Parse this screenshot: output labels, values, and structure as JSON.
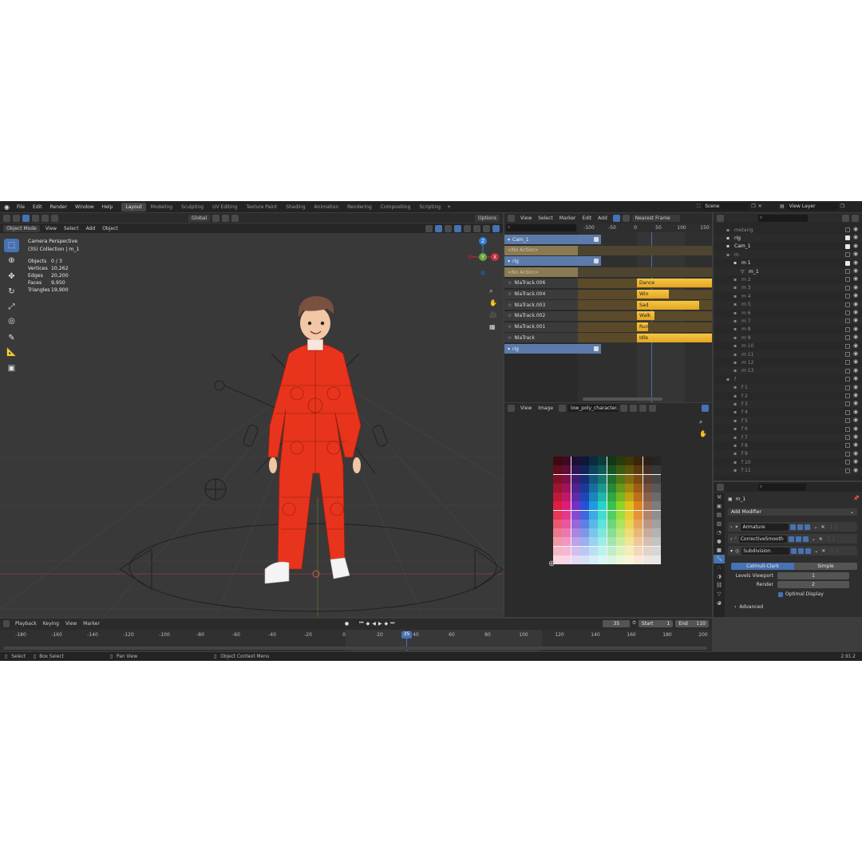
{
  "topbar": {
    "menus": [
      "File",
      "Edit",
      "Render",
      "Window",
      "Help"
    ],
    "workspaces": [
      "Layout",
      "Modeling",
      "Sculpting",
      "UV Editing",
      "Texture Paint",
      "Shading",
      "Animation",
      "Rendering",
      "Compositing",
      "Scripting"
    ],
    "active_workspace": "Layout",
    "add_tab": "+",
    "scene": "Scene",
    "view_layer": "View Layer"
  },
  "viewport": {
    "mode": "Object Mode",
    "menus": [
      "View",
      "Select",
      "Add",
      "Object"
    ],
    "orientation": "Global",
    "options": "Options",
    "camera_label": "Camera Perspective",
    "collection_label": "(35) Collection | m_1",
    "stats": [
      {
        "label": "Objects",
        "value": "0 / 3"
      },
      {
        "label": "Vertices",
        "value": "10,262"
      },
      {
        "label": "Edges",
        "value": "20,200"
      },
      {
        "label": "Faces",
        "value": "9,950"
      },
      {
        "label": "Triangles",
        "value": "19,900"
      }
    ],
    "gizmo": {
      "x": "X",
      "y": "Y",
      "z": "Z"
    }
  },
  "nla": {
    "menus": [
      "View",
      "Select",
      "Marker",
      "Edit",
      "Add"
    ],
    "snap": "Nearest Frame",
    "ticks": [
      "-100",
      "-50",
      "0",
      "50",
      "100",
      "150"
    ],
    "current_frame": "35",
    "tracks": [
      {
        "name": "Cam_1",
        "type": "object"
      },
      {
        "name": "<No Action>",
        "type": "action"
      },
      {
        "name": "rig",
        "type": "object"
      },
      {
        "name": "<No Action>",
        "type": "action"
      },
      {
        "name": "NlaTrack.006",
        "type": "track",
        "strip": "Dance"
      },
      {
        "name": "NlaTrack.004",
        "type": "track",
        "strip": "Win"
      },
      {
        "name": "NlaTrack.003",
        "type": "track",
        "strip": "Sad"
      },
      {
        "name": "NlaTrack.002",
        "type": "track",
        "strip": "Walk"
      },
      {
        "name": "NlaTrack.001",
        "type": "track",
        "strip": "Run"
      },
      {
        "name": "NlaTrack",
        "type": "track",
        "strip": "Idle"
      },
      {
        "name": "rig",
        "type": "object"
      }
    ]
  },
  "image_editor": {
    "menus": [
      "View",
      "Image"
    ],
    "image_name": "low_poly_character..."
  },
  "outliner": {
    "rows": [
      {
        "name": "metarig",
        "indent": 0,
        "dim": true
      },
      {
        "name": "rig",
        "indent": 0,
        "dim": false,
        "checked": true
      },
      {
        "name": "Cam_1",
        "indent": 0,
        "dim": false,
        "checked": true
      },
      {
        "name": "m",
        "indent": 0,
        "dim": true
      },
      {
        "name": "m 1",
        "indent": 1,
        "dim": false,
        "checked": true
      },
      {
        "name": "m_1",
        "indent": 2,
        "dim": false
      },
      {
        "name": "m 2",
        "indent": 1,
        "dim": true
      },
      {
        "name": "m 3",
        "indent": 1,
        "dim": true
      },
      {
        "name": "m 4",
        "indent": 1,
        "dim": true
      },
      {
        "name": "m 5",
        "indent": 1,
        "dim": true
      },
      {
        "name": "m 6",
        "indent": 1,
        "dim": true
      },
      {
        "name": "m 7",
        "indent": 1,
        "dim": true
      },
      {
        "name": "m 8",
        "indent": 1,
        "dim": true
      },
      {
        "name": "m 9",
        "indent": 1,
        "dim": true
      },
      {
        "name": "m 10",
        "indent": 1,
        "dim": true
      },
      {
        "name": "m 11",
        "indent": 1,
        "dim": true
      },
      {
        "name": "m 12",
        "indent": 1,
        "dim": true
      },
      {
        "name": "m 13",
        "indent": 1,
        "dim": true
      },
      {
        "name": "f",
        "indent": 0,
        "dim": true
      },
      {
        "name": "f 1",
        "indent": 1,
        "dim": true
      },
      {
        "name": "f 2",
        "indent": 1,
        "dim": true
      },
      {
        "name": "f 3",
        "indent": 1,
        "dim": true
      },
      {
        "name": "f 4",
        "indent": 1,
        "dim": true
      },
      {
        "name": "f 5",
        "indent": 1,
        "dim": true
      },
      {
        "name": "f 6",
        "indent": 1,
        "dim": true
      },
      {
        "name": "f 7",
        "indent": 1,
        "dim": true
      },
      {
        "name": "f 8",
        "indent": 1,
        "dim": true
      },
      {
        "name": "f 9",
        "indent": 1,
        "dim": true
      },
      {
        "name": "f 10",
        "indent": 1,
        "dim": true
      },
      {
        "name": "f 11",
        "indent": 1,
        "dim": true
      }
    ]
  },
  "properties": {
    "object_name": "m_1",
    "add_modifier": "Add Modifier",
    "modifiers": [
      "Armature",
      "CorrectiveSmooth",
      "Subdivision"
    ],
    "subdiv_type_a": "Catmull-Clark",
    "subdiv_type_b": "Simple",
    "levels_viewport_label": "Levels Viewport",
    "levels_viewport_value": "1",
    "render_label": "Render",
    "render_value": "2",
    "optimal_display": "Optimal Display",
    "advanced": "Advanced"
  },
  "timeline": {
    "menus": [
      "Playback",
      "Keying",
      "View",
      "Marker"
    ],
    "current_frame": "35",
    "start_label": "Start",
    "start_value": "1",
    "end_label": "End",
    "end_value": "110",
    "ticks": [
      "-180",
      "-160",
      "-140",
      "-120",
      "-100",
      "-80",
      "-60",
      "-40",
      "-20",
      "0",
      "20",
      "40",
      "60",
      "80",
      "100",
      "120",
      "140",
      "160",
      "180",
      "200"
    ]
  },
  "statusbar": {
    "select": "Select",
    "box_select": "Box Select",
    "pan_view": "Pan View",
    "context_menu": "Object Context Menu",
    "version": "2.91.2"
  },
  "colors": {
    "accent": "#4772b3",
    "strip": "#f2be3a",
    "suit": "#e8341c"
  }
}
